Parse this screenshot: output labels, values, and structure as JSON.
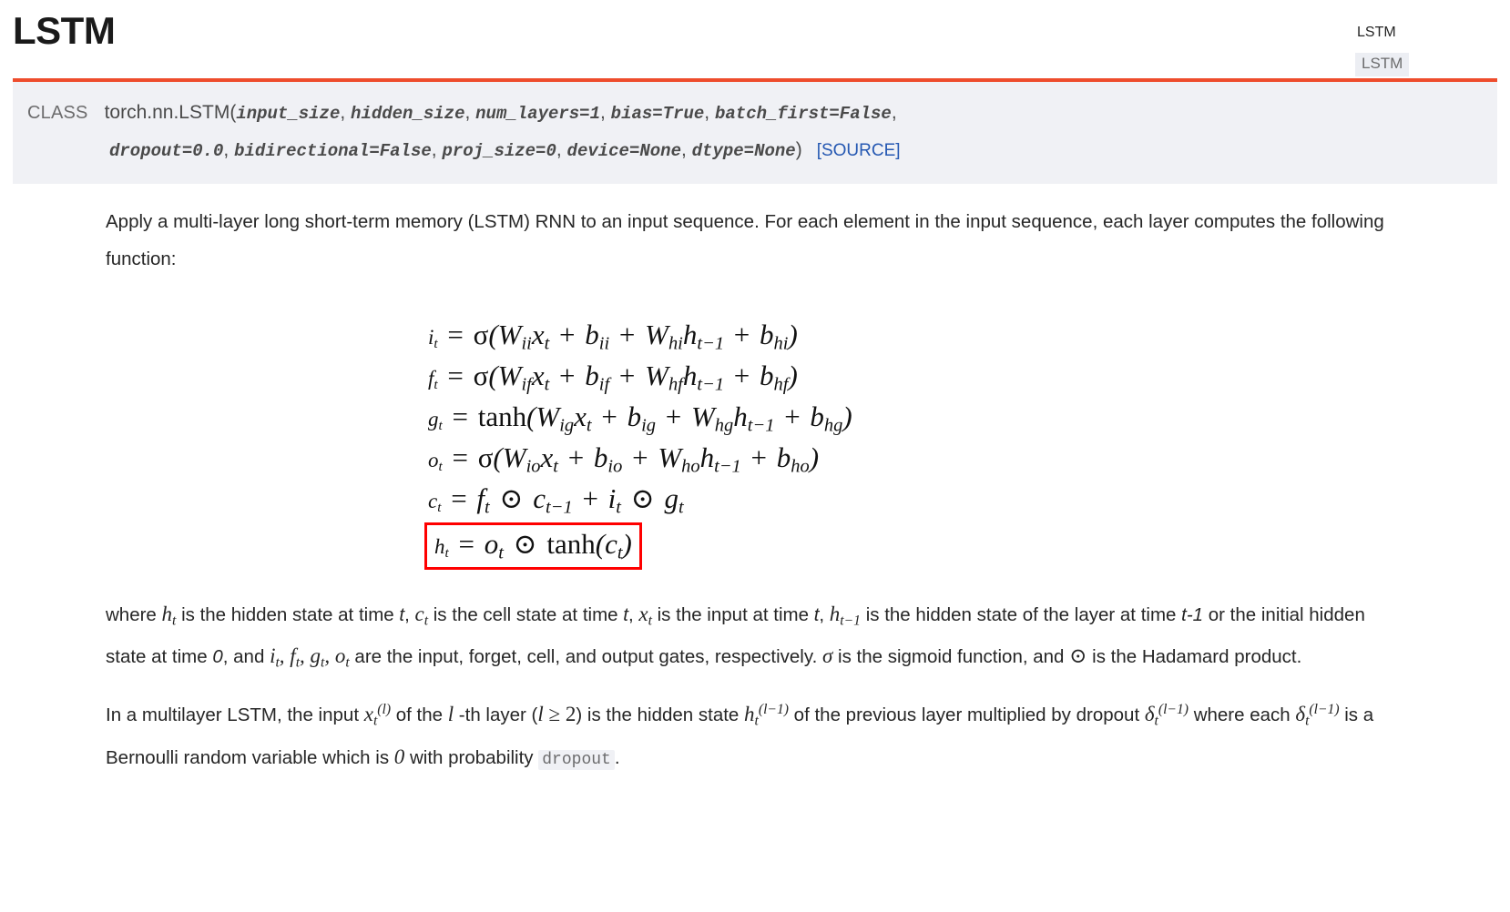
{
  "page": {
    "title": "LSTM"
  },
  "toc": {
    "heading": "LSTM",
    "link": "LSTM"
  },
  "signature": {
    "keyword": "CLASS",
    "qualname": "torch.nn.LSTM",
    "open_paren": "(",
    "close_paren": ")",
    "comma": ",",
    "source_label": "[SOURCE]",
    "params_line1": [
      "input_size",
      "hidden_size",
      "num_layers=1",
      "bias=True",
      "batch_first=False"
    ],
    "params_line2": [
      "dropout=0.0",
      "bidirectional=False",
      "proj_size=0",
      "device=None",
      "dtype=None"
    ]
  },
  "intro": {
    "text": "Apply a multi-layer long short-term memory (LSTM) RNN to an input sequence. For each element in the input sequence, each layer computes the following function:"
  },
  "equations": {
    "rows": [
      {
        "id": "input-gate",
        "lhs_var": "i",
        "lhs_sub": "t",
        "plain": "i_t = σ(W_ii x_t + b_ii + W_hi h_{t-1} + b_hi)",
        "highlighted": false
      },
      {
        "id": "forget-gate",
        "lhs_var": "f",
        "lhs_sub": "t",
        "plain": "f_t = σ(W_if x_t + b_if + W_hf h_{t-1} + b_hf)",
        "highlighted": false
      },
      {
        "id": "cell-gate",
        "lhs_var": "g",
        "lhs_sub": "t",
        "plain": "g_t = tanh(W_ig x_t + b_ig + W_hg h_{t-1} + b_hg)",
        "highlighted": false
      },
      {
        "id": "output-gate",
        "lhs_var": "o",
        "lhs_sub": "t",
        "plain": "o_t = σ(W_io x_t + b_io + W_ho h_{t-1} + b_ho)",
        "highlighted": false
      },
      {
        "id": "cell-state",
        "lhs_var": "c",
        "lhs_sub": "t",
        "plain": "c_t = f_t ⊙ c_{t-1} + i_t ⊙ g_t",
        "highlighted": false
      },
      {
        "id": "hidden-state",
        "lhs_var": "h",
        "lhs_sub": "t",
        "plain": "h_t = o_t ⊙ tanh(c_t)",
        "highlighted": true
      }
    ],
    "highlight_color": "#ff0000"
  },
  "where_paragraph": {
    "w1": "where ",
    "w2": " is the hidden state at time ",
    "w3": ", ",
    "w4": " is the cell state at time ",
    "w5": ", ",
    "w6": " is the input at time ",
    "w7": ", ",
    "w8": " is the hidden state of the layer at time ",
    "w9": " or the initial hidden state at time ",
    "w10": ", and ",
    "w11": " are the input, forget, cell, and output gates, respectively. ",
    "w12": " is the sigmoid function, and ",
    "w13": " is the Hadamard product.",
    "t_label": "t",
    "t_minus_one": "t-1",
    "zero": "0",
    "sigma": "σ",
    "hadamard": "⊙"
  },
  "multilayer_paragraph": {
    "m1": "In a multilayer LSTM, the input ",
    "m2": " of the ",
    "m3": " -th layer (",
    "m4": ") is the hidden state ",
    "m5": " of the previous layer multiplied by dropout ",
    "m6": " where each ",
    "m7": " is a Bernoulli random variable which is ",
    "m8": " with probability ",
    "m9": ".",
    "l_var": "l",
    "geq_two": "≥ 2",
    "zero": "0",
    "dropout_code": "dropout"
  },
  "colors": {
    "accent": "#ee4c2c",
    "sig_background": "#f0f1f5",
    "link": "#2558b2",
    "code_text": "#6c6c6d",
    "highlight_box": "#ff0000"
  }
}
